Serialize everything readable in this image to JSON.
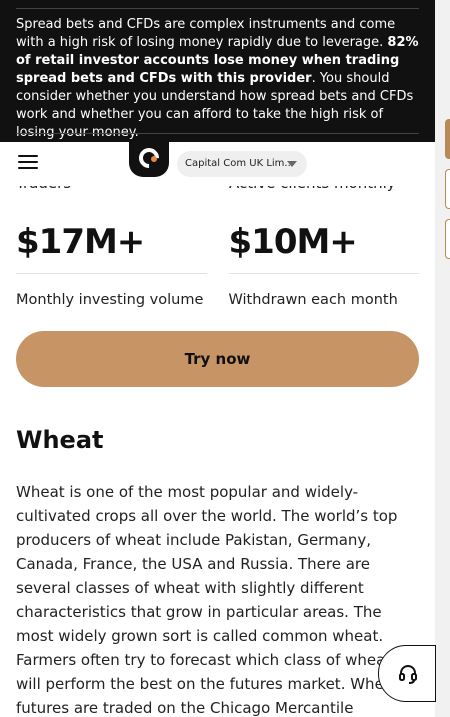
{
  "risk_banner": {
    "text_part1": "Spread bets and CFDs are complex instruments and come with a high risk of losing money rapidly due to leverage.",
    "text_bold": "82% of retail investor accounts lose money when trading spread bets and CFDs with this provider",
    "text_part2": ". You should consider whether you understand how spread bets and CFDs work and whether you can afford to take the high risk of losing your money."
  },
  "header": {
    "entity_selector": "Capital Com UK Lim..."
  },
  "stats": {
    "top_left_label": "Traders",
    "top_right_label": "Active clients monthly",
    "items": [
      {
        "value": "$17M+",
        "label": "Monthly investing volume"
      },
      {
        "value": "$10M+",
        "label": "Withdrawn each month"
      }
    ]
  },
  "cta": {
    "label": "Try now"
  },
  "article": {
    "title": "Wheat",
    "body": "Wheat is one of the most popular and widely-cultivated crops all over the world. The world’s top producers of wheat include Pakistan, Germany, Canada, France, the USA and Russia. There are several classes of wheat with slightly different characteristics that grow in particular areas. The most widely grown sort is called common wheat. Farmers often try to forecast which class of wheat will perform the best on the futures market. Wheat futures are traded on the Chicago Mercantile Exchange (CME Globex) under the"
  },
  "colors": {
    "accent": "#c69465",
    "banner_bg": "#111111"
  },
  "icons": {
    "menu": "hamburger-icon",
    "support": "headset-icon",
    "dropdown": "caret-down-icon"
  }
}
